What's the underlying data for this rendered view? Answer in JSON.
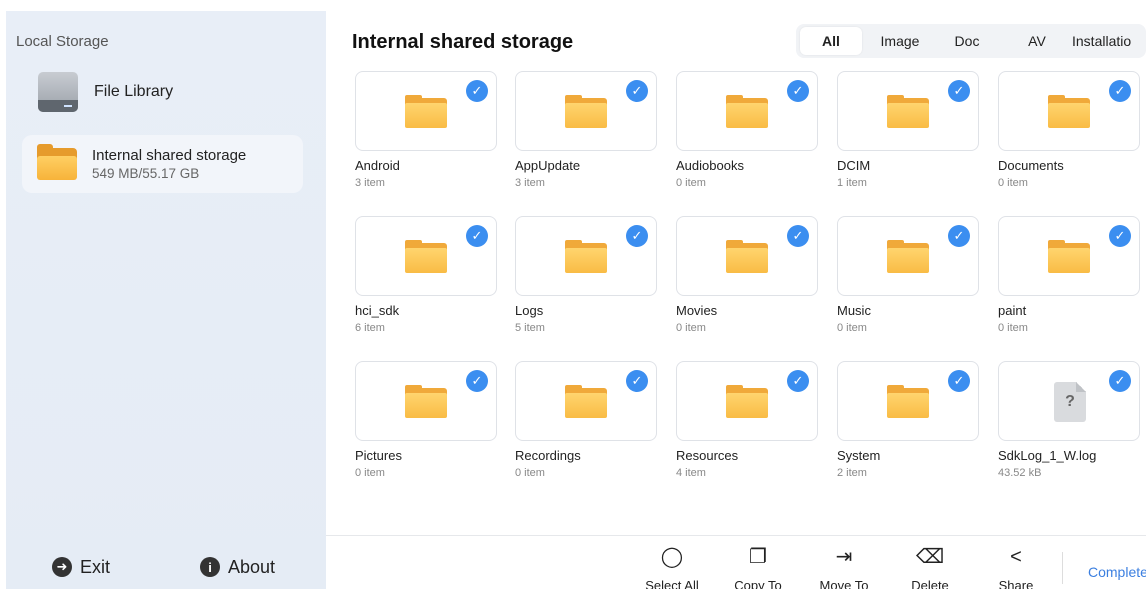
{
  "sidebar": {
    "title": "Local Storage",
    "file_library": "File Library",
    "storage": {
      "name": "Internal shared storage",
      "size": "549 MB/55.17 GB"
    },
    "exit": "Exit",
    "about": "About"
  },
  "main": {
    "title": "Internal shared storage",
    "filters": [
      "All",
      "Image",
      "Doc",
      "AV",
      "Installatio"
    ],
    "items": [
      {
        "name": "Android",
        "count": "3 item",
        "type": "folder"
      },
      {
        "name": "AppUpdate",
        "count": "3 item",
        "type": "folder"
      },
      {
        "name": "Audiobooks",
        "count": "0 item",
        "type": "folder"
      },
      {
        "name": "DCIM",
        "count": "1 item",
        "type": "folder"
      },
      {
        "name": "Documents",
        "count": "0 item",
        "type": "folder"
      },
      {
        "name": "hci_sdk",
        "count": "6 item",
        "type": "folder"
      },
      {
        "name": "Logs",
        "count": "5 item",
        "type": "folder"
      },
      {
        "name": "Movies",
        "count": "0 item",
        "type": "folder"
      },
      {
        "name": "Music",
        "count": "0 item",
        "type": "folder"
      },
      {
        "name": "paint",
        "count": "0 item",
        "type": "folder"
      },
      {
        "name": "Pictures",
        "count": "0 item",
        "type": "folder"
      },
      {
        "name": "Recordings",
        "count": "0 item",
        "type": "folder"
      },
      {
        "name": "Resources",
        "count": "4 item",
        "type": "folder"
      },
      {
        "name": "System",
        "count": "2 item",
        "type": "folder"
      },
      {
        "name": "SdkLog_1_W.log",
        "count": "43.52 kB",
        "type": "file"
      }
    ]
  },
  "toolbar": {
    "select_all": "Select All",
    "copy_to": "Copy To",
    "move_to": "Move To",
    "delete": "Delete",
    "share": "Share",
    "complete": "Complete"
  },
  "icons": {
    "check": "check-icon",
    "unknown_file": "?"
  },
  "colors": {
    "accent": "#3b8ef0",
    "folder": "#f9bc45",
    "sidebar_bg": "#e8eef7"
  }
}
